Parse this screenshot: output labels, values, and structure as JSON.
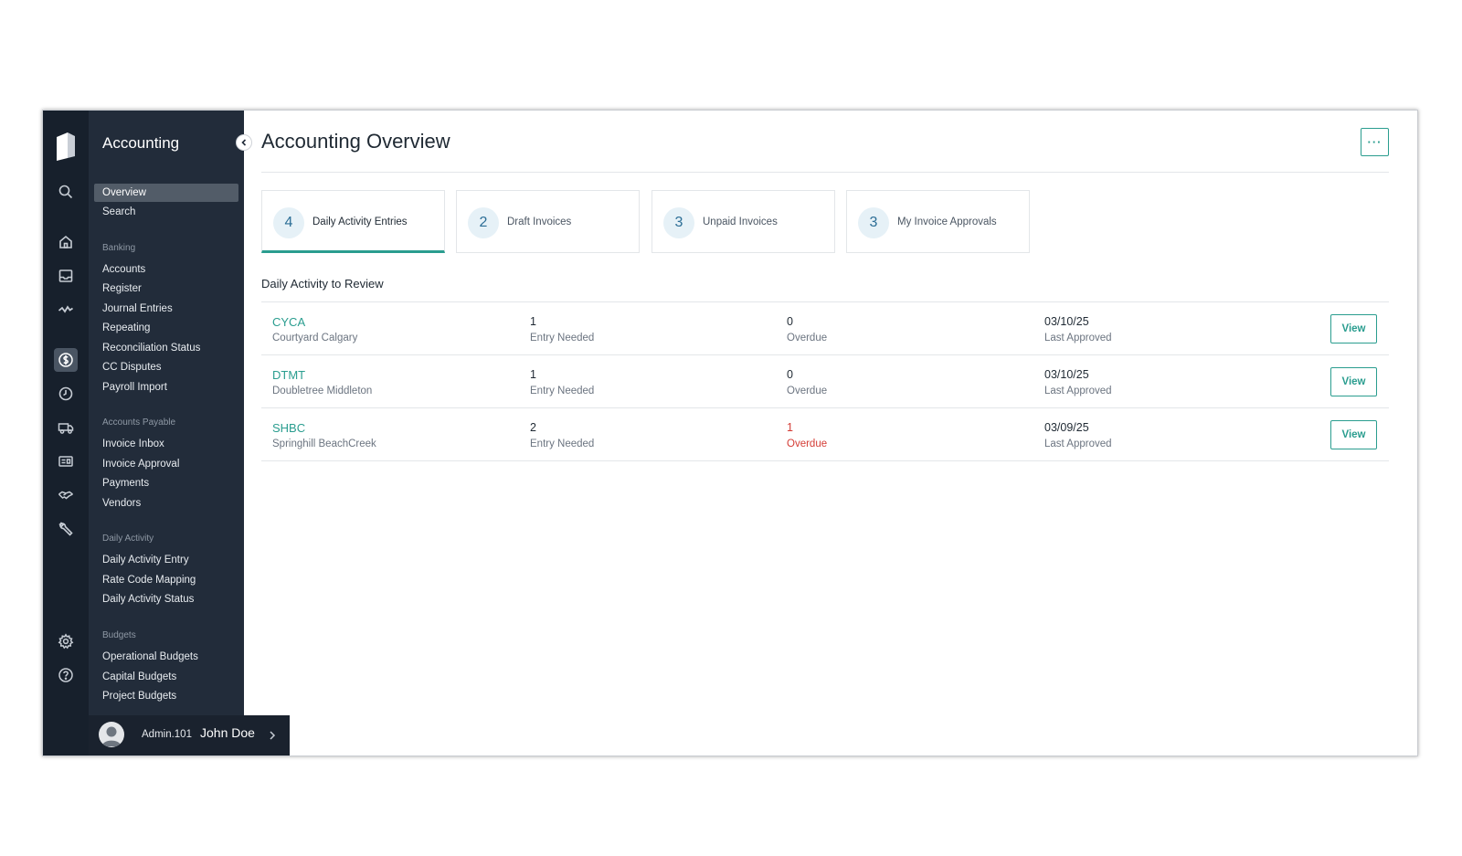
{
  "app": {
    "title": "Accounting"
  },
  "page": {
    "title": "Accounting Overview",
    "more_label": "···"
  },
  "rail_icons": [
    "search-icon",
    "home-icon",
    "inbox-icon",
    "activity-icon",
    "dollar-icon",
    "clock-icon",
    "truck-icon",
    "card-icon",
    "handshake-icon",
    "wrench-icon",
    "gear-icon",
    "help-icon"
  ],
  "nav": {
    "top_items": [
      {
        "label": "Overview",
        "active": true
      },
      {
        "label": "Search",
        "active": false
      }
    ],
    "sections": [
      {
        "title": "Banking",
        "items": [
          "Accounts",
          "Register",
          "Journal Entries",
          "Repeating",
          "Reconciliation Status",
          "CC Disputes",
          "Payroll Import"
        ]
      },
      {
        "title": "Accounts Payable",
        "items": [
          "Invoice Inbox",
          "Invoice Approval",
          "Payments",
          "Vendors"
        ]
      },
      {
        "title": "Daily Activity",
        "items": [
          "Daily Activity Entry",
          "Rate Code Mapping",
          "Daily Activity Status"
        ]
      },
      {
        "title": "Budgets",
        "items": [
          "Operational Budgets",
          "Capital Budgets",
          "Project Budgets"
        ]
      }
    ]
  },
  "user": {
    "id": "Admin.101",
    "name": "John Doe"
  },
  "stat_cards": [
    {
      "count": "4",
      "label": "Daily Activity Entries",
      "active": true
    },
    {
      "count": "2",
      "label": "Draft Invoices",
      "active": false
    },
    {
      "count": "3",
      "label": "Unpaid Invoices",
      "active": false
    },
    {
      "count": "3",
      "label": "My Invoice Approvals",
      "active": false
    }
  ],
  "review": {
    "title": "Daily Activity to Review",
    "rows": [
      {
        "code": "CYCA",
        "name": "Courtyard Calgary",
        "entries": "1",
        "entries_label": "Entry Needed",
        "overdue": "0",
        "overdue_label": "Overdue",
        "overdue_alert": false,
        "date": "03/10/25",
        "date_label": "Last Approved",
        "action": "View"
      },
      {
        "code": "DTMT",
        "name": "Doubletree Middleton",
        "entries": "1",
        "entries_label": "Entry Needed",
        "overdue": "0",
        "overdue_label": "Overdue",
        "overdue_alert": false,
        "date": "03/10/25",
        "date_label": "Last Approved",
        "action": "View"
      },
      {
        "code": "SHBC",
        "name": "Springhill BeachCreek",
        "entries": "2",
        "entries_label": "Entry Needed",
        "overdue": "1",
        "overdue_label": "Overdue",
        "overdue_alert": true,
        "date": "03/09/25",
        "date_label": "Last Approved",
        "action": "View"
      }
    ]
  },
  "colors": {
    "accent": "#2a9d8f",
    "sidebar": "#222c3a",
    "rail": "#17202c",
    "alert": "#d43c35",
    "badge_bg": "#e6f1f7"
  }
}
